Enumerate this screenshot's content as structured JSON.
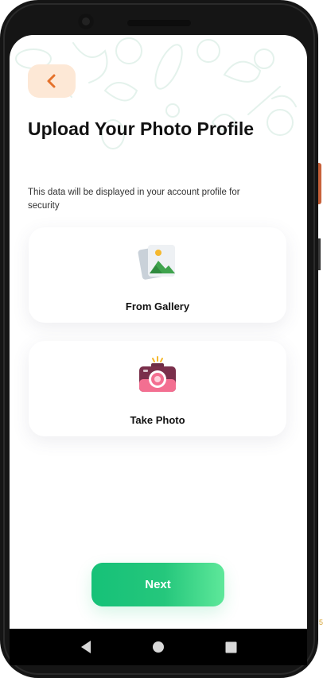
{
  "header": {
    "back_icon": "chevron-left-icon"
  },
  "title": "Upload Your Photo Profile",
  "subtitle": "This data will be displayed in your account profile for security",
  "options": [
    {
      "label": "From Gallery",
      "icon": "gallery-icon"
    },
    {
      "label": "Take Photo",
      "icon": "camera-icon"
    }
  ],
  "next_button": {
    "label": "Next"
  },
  "navbar": {
    "back_icon": "triangle-back-icon",
    "home_icon": "circle-home-icon",
    "recents_icon": "square-recents-icon"
  },
  "edge_text": "5",
  "colors": {
    "accent_orange": "#e5722c",
    "back_bg": "#fde8d6",
    "button_green": "#16c178",
    "doodle": "#e4f2ec"
  }
}
